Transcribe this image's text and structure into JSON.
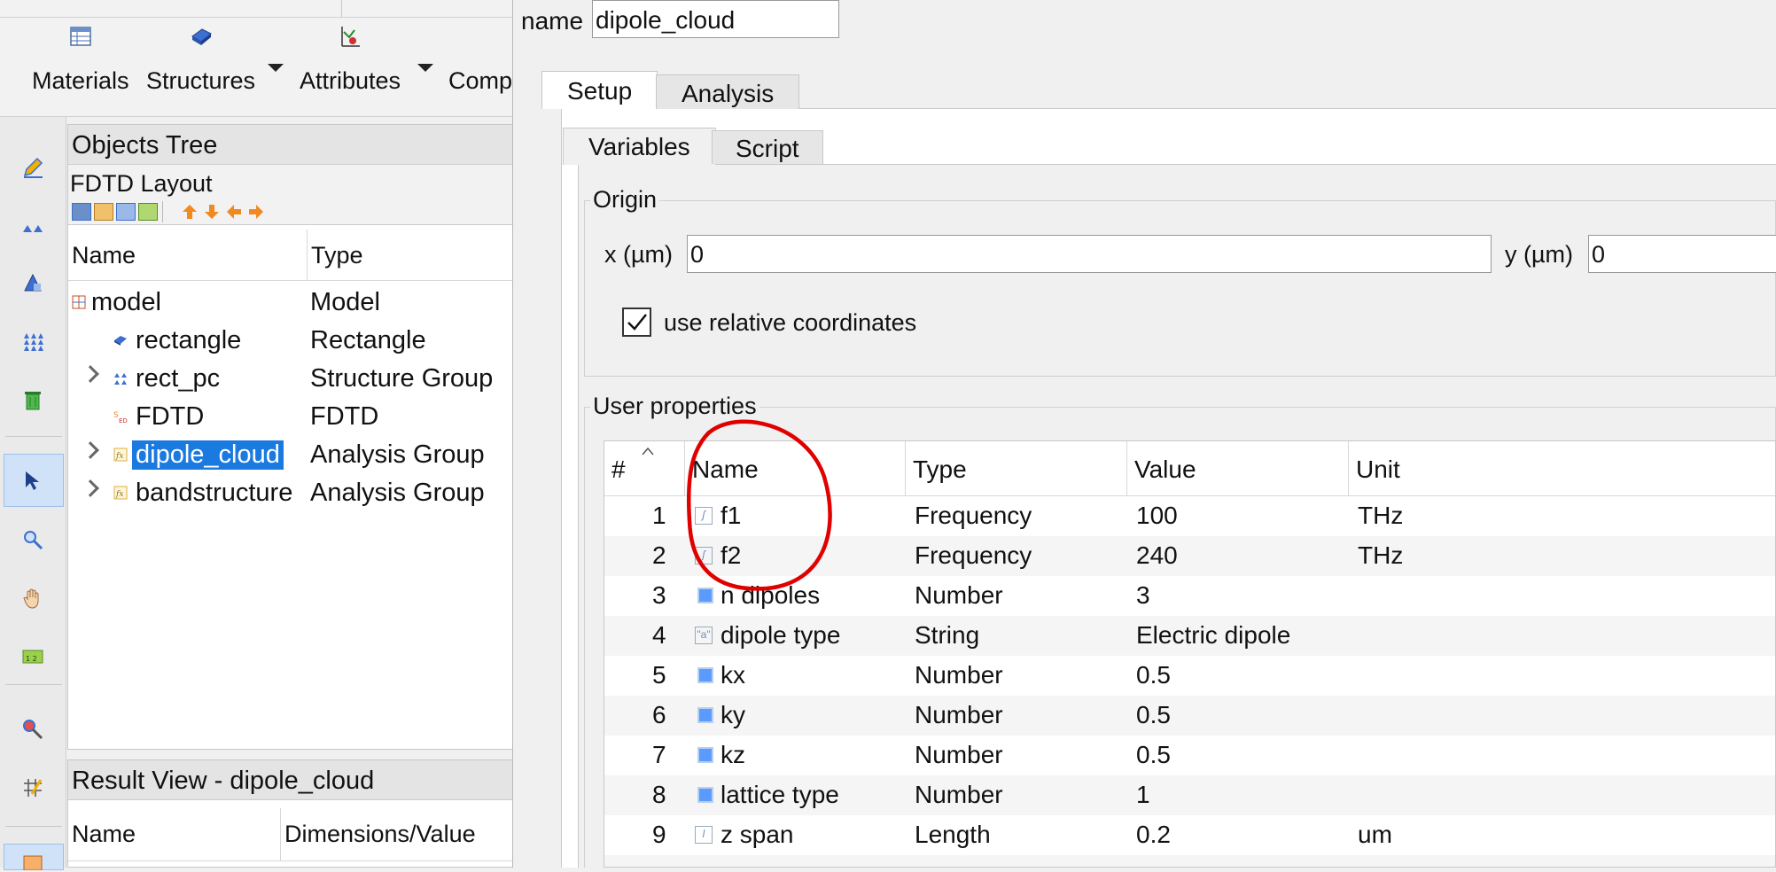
{
  "toolbar": {
    "materials": "Materials",
    "structures": "Structures",
    "attributes": "Attributes",
    "components": "Compo"
  },
  "objects_tree": {
    "title": "Objects Tree",
    "layout": "FDTD Layout",
    "columns": [
      "Name",
      "Type"
    ],
    "rows": [
      {
        "name": "model",
        "type": "Model"
      },
      {
        "name": "rectangle",
        "type": "Rectangle"
      },
      {
        "name": "rect_pc",
        "type": "Structure Group"
      },
      {
        "name": "FDTD",
        "type": "FDTD"
      },
      {
        "name": "dipole_cloud",
        "type": "Analysis Group"
      },
      {
        "name": "bandstructure",
        "type": "Analysis Group"
      }
    ]
  },
  "result_view": {
    "title": "Result View - dipole_cloud",
    "columns": [
      "Name",
      "Dimensions/Value"
    ]
  },
  "dialog": {
    "name_label": "name",
    "name_value": "dipole_cloud",
    "tabs": [
      "Setup",
      "Analysis"
    ],
    "subtabs": [
      "Variables",
      "Script"
    ],
    "origin": {
      "title": "Origin",
      "x_label": "x (µm)",
      "x_value": "0",
      "y_label": "y (µm)",
      "y_value": "0",
      "relative_label": "use relative coordinates",
      "relative_checked": true
    },
    "user_properties": {
      "title": "User properties",
      "columns": [
        "#",
        "Name",
        "Type",
        "Value",
        "Unit"
      ],
      "rows": [
        {
          "num": "1",
          "name": "f1",
          "type": "Frequency",
          "value": "100",
          "unit": "THz",
          "icon": "function-icon"
        },
        {
          "num": "2",
          "name": "f2",
          "type": "Frequency",
          "value": "240",
          "unit": "THz",
          "icon": "function-icon"
        },
        {
          "num": "3",
          "name": "n dipoles",
          "type": "Number",
          "value": "3",
          "unit": "",
          "icon": "number-icon"
        },
        {
          "num": "4",
          "name": "dipole type",
          "type": "String",
          "value": "Electric dipole",
          "unit": "",
          "icon": "string-icon"
        },
        {
          "num": "5",
          "name": "kx",
          "type": "Number",
          "value": "0.5",
          "unit": "",
          "icon": "number-icon"
        },
        {
          "num": "6",
          "name": "ky",
          "type": "Number",
          "value": "0.5",
          "unit": "",
          "icon": "number-icon"
        },
        {
          "num": "7",
          "name": "kz",
          "type": "Number",
          "value": "0.5",
          "unit": "",
          "icon": "number-icon"
        },
        {
          "num": "8",
          "name": "lattice type",
          "type": "Number",
          "value": "1",
          "unit": "",
          "icon": "number-icon"
        },
        {
          "num": "9",
          "name": "z span",
          "type": "Length",
          "value": "0.2",
          "unit": "um",
          "icon": "length-icon"
        }
      ]
    }
  },
  "colors": {
    "selection": "#1a7ae0",
    "annotation": "#e00000"
  }
}
